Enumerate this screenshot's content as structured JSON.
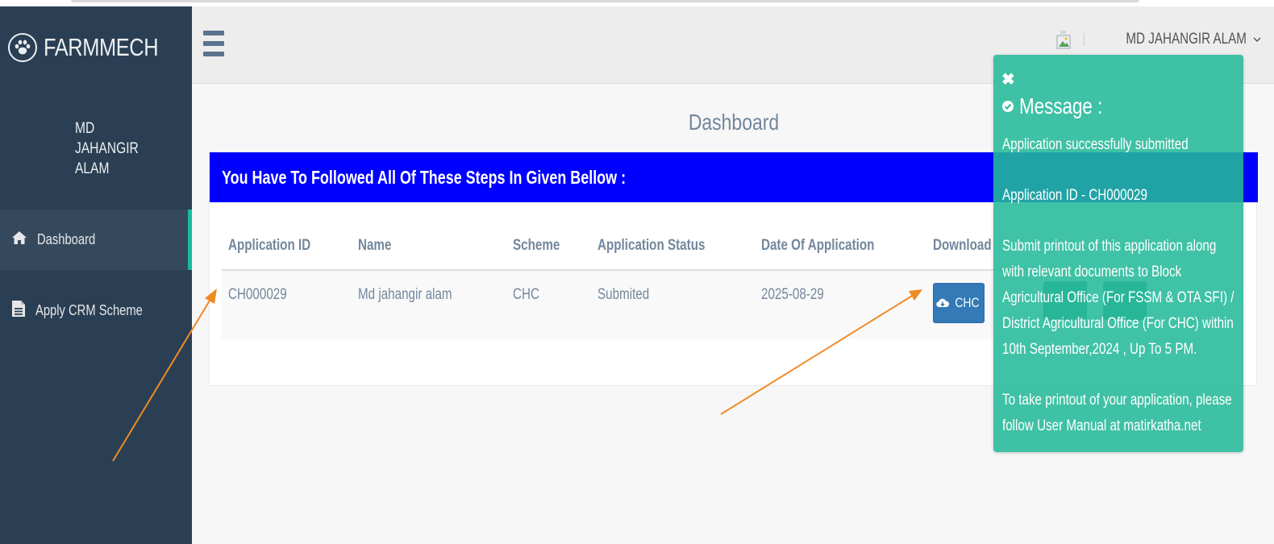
{
  "brand": {
    "name": "FARMMECH",
    "icon": "paw-icon"
  },
  "sidebar": {
    "profile_name": "MD JAHANGIR ALAM",
    "items": [
      {
        "label": "Dashboard",
        "icon": "home-icon",
        "active": true
      },
      {
        "label": "Apply CRM Scheme",
        "icon": "file-icon",
        "active": false
      }
    ]
  },
  "header": {
    "menu_icon": "hamburger-icon",
    "user_name": "MD JAHANGIR ALAM",
    "user_caret": "chevron-down-icon"
  },
  "main": {
    "title": "Dashboard",
    "panel_heading": "You Have To Followed All Of These Steps In Given Bellow :",
    "table": {
      "headers": [
        "Application ID",
        "Name",
        "Scheme",
        "Application Status",
        "Date Of Application",
        "Download"
      ],
      "rows": [
        {
          "application_id": "CH000029",
          "name": "Md jahangir alam",
          "scheme": "CHC",
          "status": "Submited",
          "date": "2025-08-29",
          "download_label": "CHC"
        }
      ]
    }
  },
  "notification": {
    "title": "Message :",
    "lines": [
      "Application successfully submitted",
      "Application ID - CH000029",
      "Submit printout of this application along with relevant documents to Block Agricultural Office (For FSSM & OTA SFI) / District Agricultural Office (For CHC) within 10th September,2024 , Up To 5 PM.",
      "To take printout of your application, please follow User Manual at matirkatha.net"
    ]
  },
  "colors": {
    "sidebar": "#2a3f54",
    "accent": "#1abb9c",
    "panel_heading": "#0000ff",
    "notification": "#26b99a",
    "button": "#337ab7",
    "arrow": "#f08a24"
  }
}
